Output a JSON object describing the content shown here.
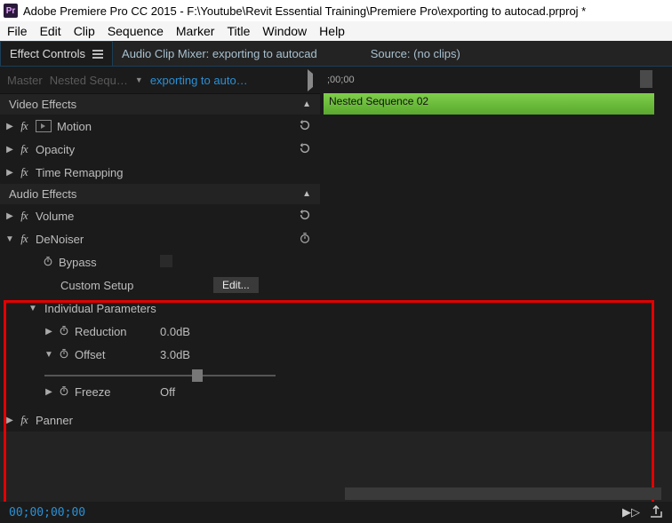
{
  "window": {
    "title": "Adobe Premiere Pro CC 2015 - F:\\Youtube\\Revit Essential Training\\Premiere Pro\\exporting to autocad.prproj *",
    "icon_label": "Pr"
  },
  "menu": {
    "items": [
      "File",
      "Edit",
      "Clip",
      "Sequence",
      "Marker",
      "Title",
      "Window",
      "Help"
    ]
  },
  "tabs": {
    "active": "Effect Controls",
    "mixer": "Audio Clip Mixer: exporting to autocad",
    "source": "Source: (no clips)"
  },
  "breadcrumb": {
    "master": "Master",
    "nested": "Nested Sequ…",
    "current": "exporting to auto…"
  },
  "sections": {
    "video_effects": "Video Effects",
    "audio_effects": "Audio Effects"
  },
  "video": {
    "motion": "Motion",
    "opacity": "Opacity",
    "time_remapping": "Time Remapping"
  },
  "audio": {
    "volume": "Volume",
    "denoiser": {
      "name": "DeNoiser",
      "bypass": "Bypass",
      "custom_setup": "Custom Setup",
      "edit": "Edit...",
      "individual_parameters": "Individual Parameters",
      "reduction": {
        "label": "Reduction",
        "value": "0.0dB"
      },
      "offset": {
        "label": "Offset",
        "value": "3.0dB",
        "slider_pct": 64
      },
      "freeze": {
        "label": "Freeze",
        "value": "Off"
      }
    },
    "panner": "Panner"
  },
  "timeline": {
    "start_label": ";00;00",
    "clip_name": "Nested Sequence 02"
  },
  "footer": {
    "timecode": "00;00;00;00"
  }
}
